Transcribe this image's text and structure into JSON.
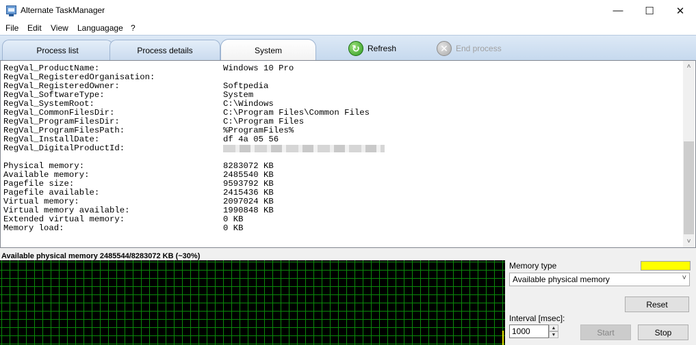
{
  "window": {
    "title": "Alternate TaskManager",
    "controls": {
      "minimize": "—",
      "maximize": "☐",
      "close": "✕"
    }
  },
  "menu": [
    "File",
    "Edit",
    "View",
    "Languagage",
    "?"
  ],
  "tabs": [
    {
      "label": "Process list",
      "active": false
    },
    {
      "label": "Process details",
      "active": false
    },
    {
      "label": "System",
      "active": true
    }
  ],
  "toolbar": {
    "refresh_label": "Refresh",
    "refresh_icon": "refresh-icon",
    "end_process_label": "End process",
    "end_process_icon": "end-process-icon",
    "end_process_enabled": false
  },
  "system_info": {
    "registry_rows": [
      {
        "key": "RegVal_ProductName:",
        "value": "Windows 10 Pro"
      },
      {
        "key": "RegVal_RegisteredOrganisation:",
        "value": ""
      },
      {
        "key": "RegVal_RegisteredOwner:",
        "value": "Softpedia"
      },
      {
        "key": "RegVal_SoftwareType:",
        "value": "System"
      },
      {
        "key": "RegVal_SystemRoot:",
        "value": "C:\\Windows"
      },
      {
        "key": "RegVal_CommonFilesDir:",
        "value": "C:\\Program Files\\Common Files"
      },
      {
        "key": "RegVal_ProgramFilesDir:",
        "value": "C:\\Program Files"
      },
      {
        "key": "RegVal_ProgramFilesPath:",
        "value": "%ProgramFiles%"
      },
      {
        "key": "RegVal_InstallDate:",
        "value": "df 4a 05 56"
      },
      {
        "key": "RegVal_DigitalProductId:",
        "value": ""
      }
    ],
    "memory_rows": [
      {
        "key": "Physical memory:",
        "value": "8283072 KB"
      },
      {
        "key": "Available memory:",
        "value": "2485540 KB"
      },
      {
        "key": "Pagefile size:",
        "value": "9593792 KB"
      },
      {
        "key": "Pagefile available:",
        "value": "2415436 KB"
      },
      {
        "key": "Virtual memory:",
        "value": "2097024 KB"
      },
      {
        "key": "Virtual memory available:",
        "value": "1990848 KB"
      },
      {
        "key": "Extended virtual memory:",
        "value": "0 KB"
      },
      {
        "key": "Memory load:",
        "value": "0 KB"
      }
    ]
  },
  "graph": {
    "title": "Available physical memory 2485544/8283072 KB (~30%)",
    "background": "#000000",
    "grid_color": "#0a8a0a",
    "line_color": "#e8e800"
  },
  "controls": {
    "memory_type_label": "Memory type",
    "memory_type_color": "#ffff00",
    "memory_type_selected": "Available physical memory",
    "reset_label": "Reset",
    "interval_label": "Interval [msec]:",
    "interval_value": "1000",
    "start_label": "Start",
    "start_enabled": false,
    "stop_label": "Stop"
  }
}
